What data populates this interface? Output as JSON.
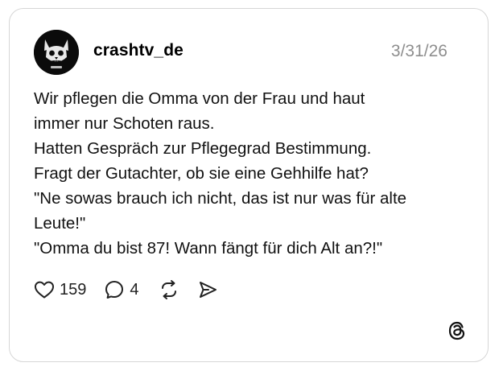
{
  "post": {
    "username": "crashtv_de",
    "date": "3/31/26",
    "lines": [
      "Wir pflegen die Omma von der Frau und haut",
      "immer nur Schoten raus.",
      "Hatten Gespräch zur Pflegegrad Bestimmung.",
      "Fragt der Gutachter, ob sie eine Gehhilfe hat?",
      "\"Ne sowas brauch ich nicht, das ist nur was für alte",
      "Leute!\"",
      "\"Omma du bist 87! Wann fängt für dich Alt an?!\""
    ]
  },
  "actions": {
    "likes": "159",
    "comments": "4"
  },
  "icons": {
    "like": "heart-icon",
    "comment": "comment-bubble-icon",
    "repost": "repost-icon",
    "share": "send-icon",
    "brand": "threads-logo-icon"
  }
}
